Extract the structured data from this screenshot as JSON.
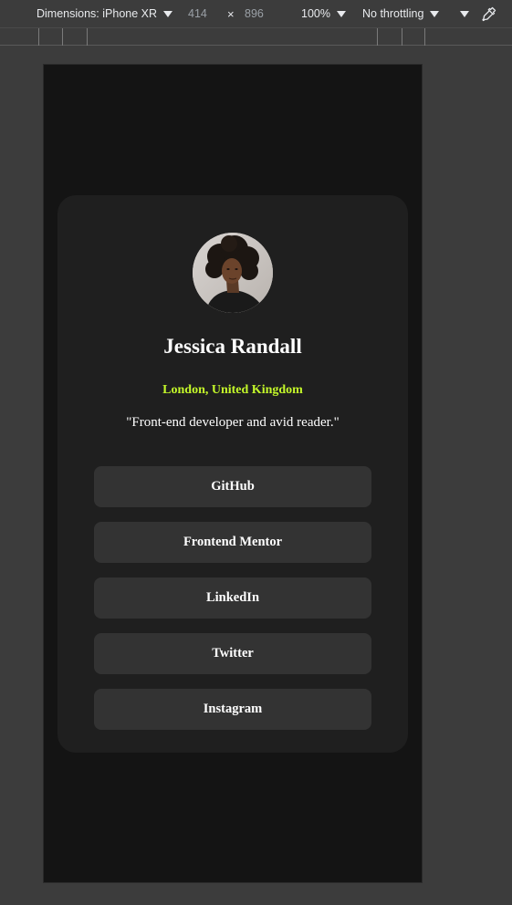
{
  "devtools": {
    "dimensions_label": "Dimensions: iPhone XR",
    "width": "414",
    "times": "×",
    "height": "896",
    "zoom": "100%",
    "throttling": "No throttling"
  },
  "profile": {
    "name": "Jessica Randall",
    "location": "London, United Kingdom",
    "bio": "\"Front-end developer and avid reader.\""
  },
  "links": [
    {
      "label": "GitHub"
    },
    {
      "label": "Frontend Mentor"
    },
    {
      "label": "LinkedIn"
    },
    {
      "label": "Twitter"
    },
    {
      "label": "Instagram"
    }
  ],
  "colors": {
    "page_background": "#141414",
    "card_background": "#1f1f1f",
    "button_background": "#333333",
    "accent_green": "#c4f82a",
    "text_white": "#ffffff"
  }
}
